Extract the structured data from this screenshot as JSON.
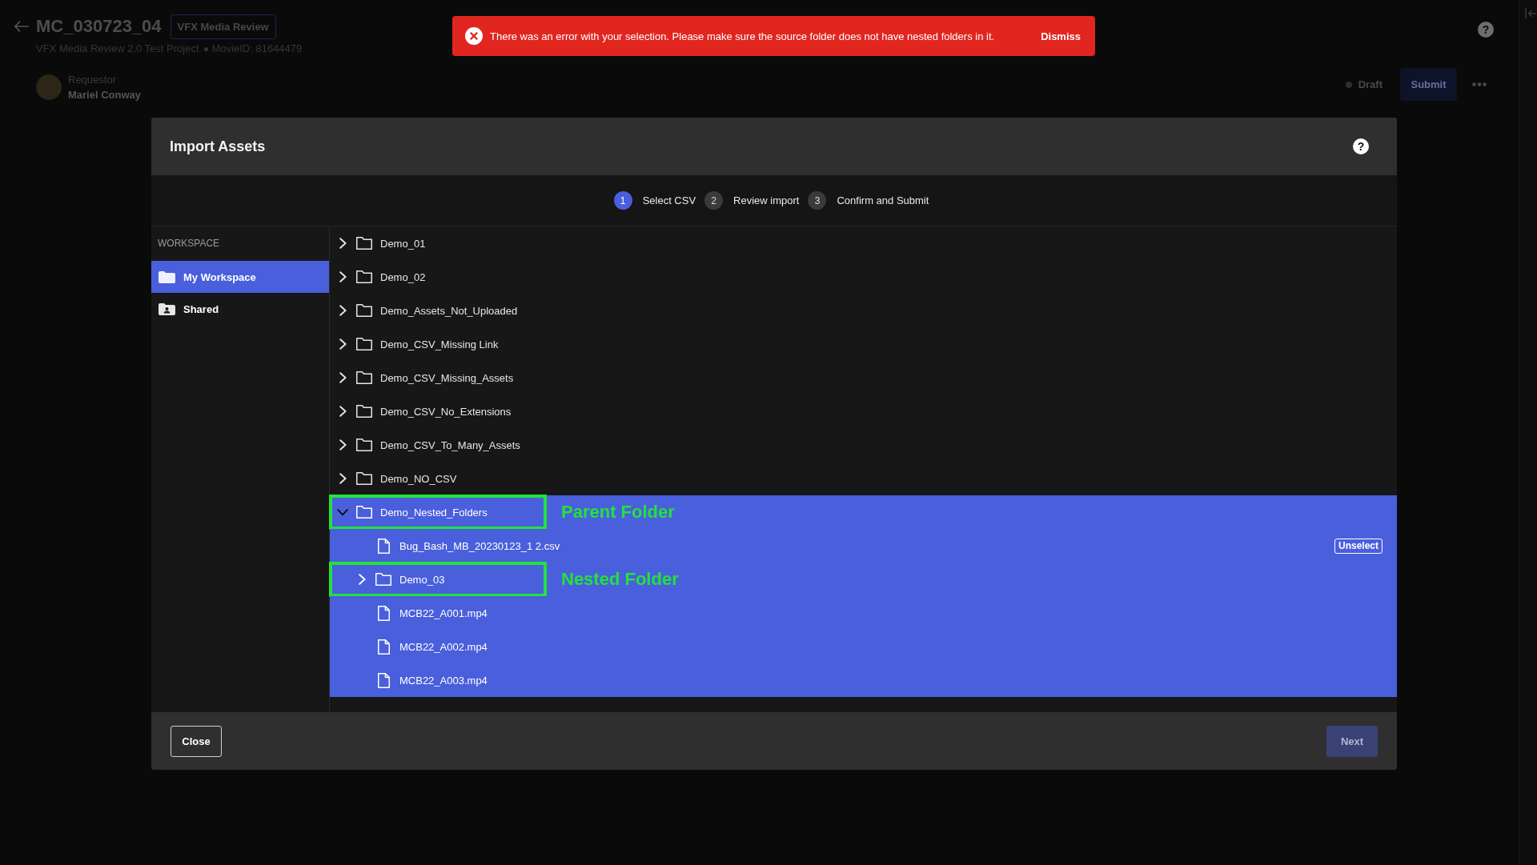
{
  "page_header": {
    "title": "MC_030723_04",
    "badge": "VFX Media Review",
    "project": "VFX Media Review 2.0 Test Project",
    "movie_id": "MovieID: 81644479",
    "requestor_label": "Requestor",
    "requestor_name": "Mariel Conway",
    "help": "?",
    "status": "Draft",
    "submit": "Submit"
  },
  "error_banner": {
    "message": "There was an error with your selection. Please make sure the source folder does not have nested folders in it.",
    "action": "Dismiss"
  },
  "dialog": {
    "title": "Import Assets",
    "help": "?",
    "steps": [
      {
        "number": "1",
        "label": "Select CSV",
        "selected": true
      },
      {
        "number": "2",
        "label": "Review import",
        "selected": false
      },
      {
        "number": "3",
        "label": "Confirm and Submit",
        "selected": false
      }
    ],
    "sidebar": {
      "heading": "WORKSPACE",
      "items": [
        {
          "label": "My Workspace",
          "kind": "folder",
          "selected": true
        },
        {
          "label": "Shared",
          "kind": "shared",
          "selected": false
        }
      ]
    },
    "tree": [
      {
        "name": "Demo_01",
        "kind": "folder",
        "expanded": false,
        "selected": false
      },
      {
        "name": "Demo_02",
        "kind": "folder",
        "expanded": false,
        "selected": false
      },
      {
        "name": "Demo_Assets_Not_Uploaded",
        "kind": "folder",
        "expanded": false,
        "selected": false
      },
      {
        "name": "Demo_CSV_Missing Link",
        "kind": "folder",
        "expanded": false,
        "selected": false
      },
      {
        "name": "Demo_CSV_Missing_Assets",
        "kind": "folder",
        "expanded": false,
        "selected": false
      },
      {
        "name": "Demo_CSV_No_Extensions",
        "kind": "folder",
        "expanded": false,
        "selected": false
      },
      {
        "name": "Demo_CSV_To_Many_Assets",
        "kind": "folder",
        "expanded": false,
        "selected": false
      },
      {
        "name": "Demo_NO_CSV",
        "kind": "folder",
        "expanded": false,
        "selected": false
      },
      {
        "name": "Demo_Nested_Folders",
        "kind": "folder",
        "expanded": true,
        "selected": true,
        "annotation": "Parent Folder",
        "children": [
          {
            "name": "Bug_Bash_MB_20230123_1 2.csv",
            "kind": "file",
            "selected": true,
            "action": "Unselect"
          },
          {
            "name": "Demo_03",
            "kind": "folder",
            "expanded": false,
            "selected": true,
            "annotation": "Nested Folder"
          },
          {
            "name": "MCB22_A001.mp4",
            "kind": "file",
            "selected": true
          },
          {
            "name": "MCB22_A002.mp4",
            "kind": "file",
            "selected": true
          },
          {
            "name": "MCB22_A003.mp4",
            "kind": "file",
            "selected": true
          }
        ]
      }
    ],
    "buttons": [
      {
        "label": "Close",
        "kind": "close",
        "disabled": false
      },
      {
        "label": "Next",
        "kind": "next",
        "disabled": true
      }
    ]
  }
}
